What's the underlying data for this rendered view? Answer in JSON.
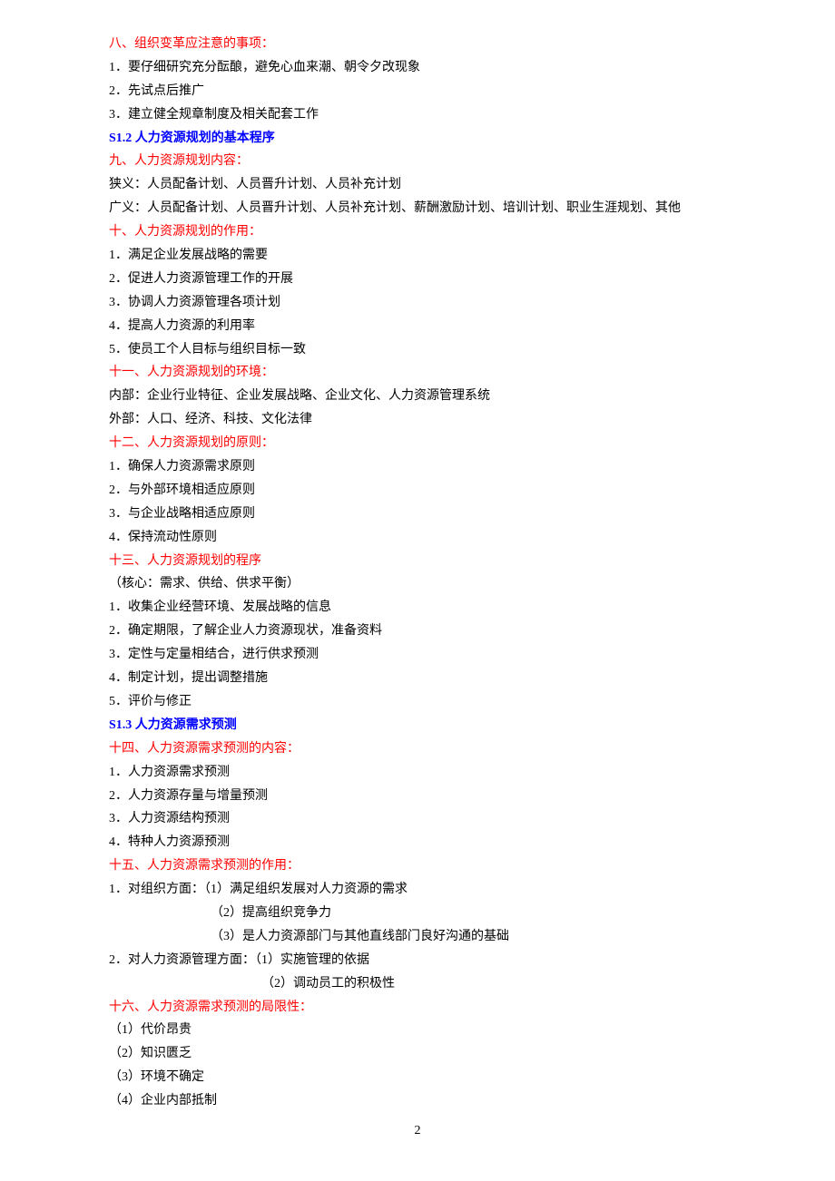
{
  "sections": {
    "s8": {
      "heading": "八、组织变革应注意的事项：",
      "items": [
        "1．要仔细研究充分酝酿，避免心血来潮、朝令夕改现象",
        "2．先试点后推广",
        "3．建立健全规章制度及相关配套工作"
      ]
    },
    "s1_2_title": "S1.2 人力资源规划的基本程序",
    "s9": {
      "heading": "九、人力资源规划内容：",
      "items": [
        "狭义：人员配备计划、人员晋升计划、人员补充计划",
        "广义：人员配备计划、人员晋升计划、人员补充计划、薪酬激励计划、培训计划、职业生涯规划、其他"
      ]
    },
    "s10": {
      "heading": "十、人力资源规划的作用：",
      "items": [
        "1．满足企业发展战略的需要",
        "2．促进人力资源管理工作的开展",
        "3．协调人力资源管理各项计划",
        "4．提高人力资源的利用率",
        "5．使员工个人目标与组织目标一致"
      ]
    },
    "s11": {
      "heading": "十一、人力资源规划的环境：",
      "items": [
        "内部：企业行业特征、企业发展战略、企业文化、人力资源管理系统",
        "外部：人口、经济、科技、文化法律"
      ]
    },
    "s12": {
      "heading": "十二、人力资源规划的原则：",
      "items": [
        "1．确保人力资源需求原则",
        "2．与外部环境相适应原则",
        "3．与企业战略相适应原则",
        "4．保持流动性原则"
      ]
    },
    "s13": {
      "heading": "十三、人力资源规划的程序",
      "items": [
        "（核心：需求、供给、供求平衡）",
        "1．收集企业经营环境、发展战略的信息",
        "2．确定期限，了解企业人力资源现状，准备资料",
        "3．定性与定量相结合，进行供求预测",
        "4．制定计划，提出调整措施",
        "5．评价与修正"
      ]
    },
    "s1_3_title": "S1.3 人力资源需求预测",
    "s14": {
      "heading": "十四、人力资源需求预测的内容：",
      "items": [
        "1．人力资源需求预测",
        "2．人力资源存量与增量预测",
        "3．人力资源结构预测",
        "4．特种人力资源预测"
      ]
    },
    "s15": {
      "heading": "十五、人力资源需求预测的作用：",
      "line1": "1．对组织方面：（1）满足组织发展对人力资源的需求",
      "line1_sub2": "（2）提高组织竞争力",
      "line1_sub3": "（3）是人力资源部门与其他直线部门良好沟通的基础",
      "line2": "2．对人力资源管理方面：（1）实施管理的依据",
      "line2_sub2": "（2）调动员工的积极性"
    },
    "s16": {
      "heading": "十六、人力资源需求预测的局限性：",
      "items": [
        "（1）代价昂贵",
        "（2）知识匮乏",
        "（3）环境不确定",
        "（4）企业内部抵制"
      ]
    }
  },
  "page_number": "2"
}
